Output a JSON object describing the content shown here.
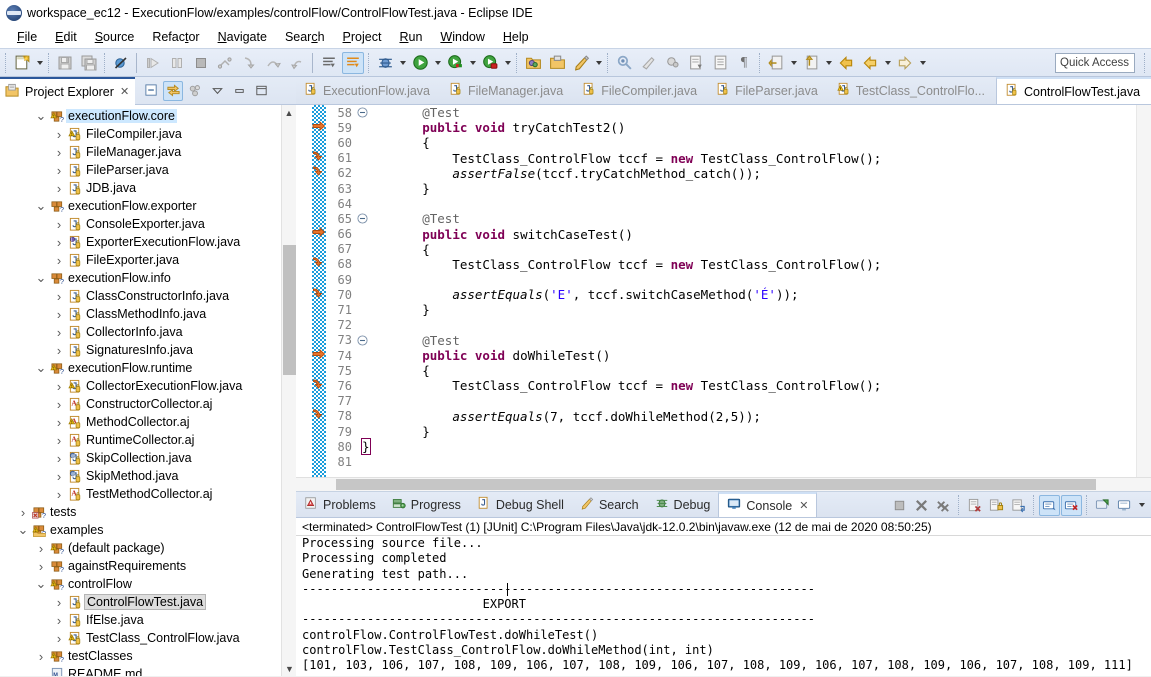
{
  "window": {
    "title": "workspace_ec12 - ExecutionFlow/examples/controlFlow/ControlFlowTest.java - Eclipse IDE",
    "logo_icon": "eclipse-logo-icon"
  },
  "menubar": {
    "items": [
      {
        "label": "File",
        "mnemonic": "F"
      },
      {
        "label": "Edit",
        "mnemonic": "E"
      },
      {
        "label": "Source",
        "mnemonic": "S"
      },
      {
        "label": "Refactor",
        "mnemonic": "t"
      },
      {
        "label": "Navigate",
        "mnemonic": "N"
      },
      {
        "label": "Search",
        "mnemonic": "c"
      },
      {
        "label": "Project",
        "mnemonic": "P"
      },
      {
        "label": "Run",
        "mnemonic": "R"
      },
      {
        "label": "Window",
        "mnemonic": "W"
      },
      {
        "label": "Help",
        "mnemonic": "H"
      }
    ]
  },
  "toolbar": {
    "quick_access_placeholder": "Quick Access",
    "buttons": [
      {
        "name": "new-wizard-icon",
        "tooltip": "New"
      },
      {
        "name": "save-icon",
        "tooltip": "Save"
      },
      {
        "name": "save-all-icon",
        "tooltip": "Save All"
      },
      {
        "name": "skip-all-breakpoints-icon",
        "tooltip": "Skip All Breakpoints"
      },
      {
        "name": "resume-icon",
        "tooltip": "Resume"
      },
      {
        "name": "suspend-icon",
        "tooltip": "Suspend"
      },
      {
        "name": "terminate-icon",
        "tooltip": "Terminate"
      },
      {
        "name": "disconnect-icon",
        "tooltip": "Disconnect"
      },
      {
        "name": "step-into-icon",
        "tooltip": "Step Into"
      },
      {
        "name": "step-over-icon",
        "tooltip": "Step Over"
      },
      {
        "name": "step-return-icon",
        "tooltip": "Step Return"
      },
      {
        "name": "next-annotation-icon",
        "tooltip": "Next Annotation"
      },
      {
        "name": "toggle-mark-occurrences-icon",
        "tooltip": "Toggle Mark Occurrences"
      },
      {
        "name": "debug-icon",
        "tooltip": "Debug"
      },
      {
        "name": "run-icon",
        "tooltip": "Run"
      },
      {
        "name": "coverage-icon",
        "tooltip": "Coverage"
      },
      {
        "name": "external-tools-icon",
        "tooltip": "External Tools"
      },
      {
        "name": "new-java-project-icon",
        "tooltip": "New Java Project"
      },
      {
        "name": "new-java-package-icon",
        "tooltip": "New Java Package"
      },
      {
        "name": "new-class-icon",
        "tooltip": "New Class"
      },
      {
        "name": "search-icon",
        "tooltip": "Search"
      },
      {
        "name": "open-task-icon",
        "tooltip": "Open Task"
      },
      {
        "name": "link-icon",
        "tooltip": "Link"
      },
      {
        "name": "open-type-icon",
        "tooltip": "Open Type"
      },
      {
        "name": "show-whitespace-icon",
        "tooltip": "Show Whitespace Characters"
      },
      {
        "name": "pilcrow-icon",
        "tooltip": "Show Paragraph Marks"
      },
      {
        "name": "previous-edit-icon",
        "tooltip": "Previous Edit Location"
      },
      {
        "name": "next-edit-icon",
        "tooltip": "Next Edit Location"
      },
      {
        "name": "back-icon",
        "tooltip": "Back"
      },
      {
        "name": "forward-icon",
        "tooltip": "Forward"
      }
    ]
  },
  "explorer": {
    "tab_label": "Project Explorer",
    "tab_icon": "project-explorer-icon",
    "close_icon": "close-icon",
    "tools": [
      {
        "name": "collapse-all-icon"
      },
      {
        "name": "link-with-editor-icon",
        "active": true
      },
      {
        "name": "focus-on-active-task-icon"
      },
      {
        "name": "view-menu-icon"
      },
      {
        "name": "minimize-icon"
      },
      {
        "name": "maximize-icon"
      }
    ],
    "tree": [
      {
        "label": "executionFlow.core",
        "indent": 1,
        "twisty": "open",
        "icon": "package-warning-icon",
        "selected": "blue"
      },
      {
        "label": "FileCompiler.java",
        "indent": 2,
        "twisty": "closed",
        "icon": "java-warning-icon"
      },
      {
        "label": "FileManager.java",
        "indent": 2,
        "twisty": "closed",
        "icon": "java-icon"
      },
      {
        "label": "FileParser.java",
        "indent": 2,
        "twisty": "closed",
        "icon": "java-icon"
      },
      {
        "label": "JDB.java",
        "indent": 2,
        "twisty": "closed",
        "icon": "java-icon"
      },
      {
        "label": "executionFlow.exporter",
        "indent": 1,
        "twisty": "open",
        "icon": "package-icon"
      },
      {
        "label": "ConsoleExporter.java",
        "indent": 2,
        "twisty": "closed",
        "icon": "java-icon"
      },
      {
        "label": "ExporterExecutionFlow.java",
        "indent": 2,
        "twisty": "closed",
        "icon": "java-interface-icon"
      },
      {
        "label": "FileExporter.java",
        "indent": 2,
        "twisty": "closed",
        "icon": "java-icon"
      },
      {
        "label": "executionFlow.info",
        "indent": 1,
        "twisty": "open",
        "icon": "package-icon"
      },
      {
        "label": "ClassConstructorInfo.java",
        "indent": 2,
        "twisty": "closed",
        "icon": "java-icon"
      },
      {
        "label": "ClassMethodInfo.java",
        "indent": 2,
        "twisty": "closed",
        "icon": "java-icon"
      },
      {
        "label": "CollectorInfo.java",
        "indent": 2,
        "twisty": "closed",
        "icon": "java-icon"
      },
      {
        "label": "SignaturesInfo.java",
        "indent": 2,
        "twisty": "closed",
        "icon": "java-icon"
      },
      {
        "label": "executionFlow.runtime",
        "indent": 1,
        "twisty": "open",
        "icon": "package-warning-icon"
      },
      {
        "label": "CollectorExecutionFlow.java",
        "indent": 2,
        "twisty": "closed",
        "icon": "java-warning-icon"
      },
      {
        "label": "ConstructorCollector.aj",
        "indent": 2,
        "twisty": "closed",
        "icon": "aspect-icon"
      },
      {
        "label": "MethodCollector.aj",
        "indent": 2,
        "twisty": "closed",
        "icon": "aspect-warning-icon"
      },
      {
        "label": "RuntimeCollector.aj",
        "indent": 2,
        "twisty": "closed",
        "icon": "aspect-icon"
      },
      {
        "label": "SkipCollection.java",
        "indent": 2,
        "twisty": "closed",
        "icon": "java-annotation-icon"
      },
      {
        "label": "SkipMethod.java",
        "indent": 2,
        "twisty": "closed",
        "icon": "java-annotation-icon"
      },
      {
        "label": "TestMethodCollector.aj",
        "indent": 2,
        "twisty": "closed",
        "icon": "aspect-icon"
      },
      {
        "label": "tests",
        "indent": 0,
        "twisty": "closed",
        "icon": "source-folder-error-icon"
      },
      {
        "label": "examples",
        "indent": 0,
        "twisty": "open",
        "icon": "source-folder-warning-icon"
      },
      {
        "label": "(default package)",
        "indent": 1,
        "twisty": "closed",
        "icon": "package-warning-icon"
      },
      {
        "label": "againstRequirements",
        "indent": 1,
        "twisty": "closed",
        "icon": "package-icon"
      },
      {
        "label": "controlFlow",
        "indent": 1,
        "twisty": "open",
        "icon": "package-warning-icon"
      },
      {
        "label": "ControlFlowTest.java",
        "indent": 2,
        "twisty": "closed",
        "icon": "java-icon",
        "selected": "grey"
      },
      {
        "label": "IfElse.java",
        "indent": 2,
        "twisty": "closed",
        "icon": "java-icon"
      },
      {
        "label": "TestClass_ControlFlow.java",
        "indent": 2,
        "twisty": "closed",
        "icon": "java-warning-icon"
      },
      {
        "label": "testClasses",
        "indent": 1,
        "twisty": "closed",
        "icon": "package-warning-icon"
      },
      {
        "label": "README.md",
        "indent": 1,
        "twisty": "none",
        "icon": "markdown-icon"
      }
    ]
  },
  "editor": {
    "tabs": [
      {
        "label": "ExecutionFlow.java",
        "icon": "java-icon",
        "active": false
      },
      {
        "label": "FileManager.java",
        "icon": "java-icon",
        "active": false
      },
      {
        "label": "FileCompiler.java",
        "icon": "java-icon",
        "active": false
      },
      {
        "label": "FileParser.java",
        "icon": "java-icon",
        "active": false
      },
      {
        "label": "TestClass_ControlFlo...",
        "icon": "java-warning-icon",
        "active": false
      },
      {
        "label": "ControlFlowTest.java",
        "icon": "java-icon",
        "active": true
      }
    ],
    "first_line": 58,
    "lines": [
      {
        "n": 58,
        "fold": true,
        "bp": false,
        "tokens": [
          {
            "t": "        ",
            "c": "plain"
          },
          {
            "t": "@Test",
            "c": "ann"
          }
        ]
      },
      {
        "n": 59,
        "fold": false,
        "bp": "arrow",
        "tokens": [
          {
            "t": "        ",
            "c": "plain"
          },
          {
            "t": "public",
            "c": "kw"
          },
          {
            "t": " ",
            "c": "plain"
          },
          {
            "t": "void",
            "c": "kw"
          },
          {
            "t": " tryCatchTest2()",
            "c": "plain"
          }
        ]
      },
      {
        "n": 60,
        "fold": false,
        "bp": false,
        "tokens": [
          {
            "t": "        {",
            "c": "plain"
          }
        ]
      },
      {
        "n": 61,
        "fold": false,
        "bp": "hook",
        "tokens": [
          {
            "t": "            TestClass_ControlFlow tccf = ",
            "c": "plain"
          },
          {
            "t": "new",
            "c": "kw"
          },
          {
            "t": " TestClass_ControlFlow();",
            "c": "plain"
          }
        ]
      },
      {
        "n": 62,
        "fold": false,
        "bp": "hook",
        "tokens": [
          {
            "t": "            ",
            "c": "plain"
          },
          {
            "t": "assertFalse",
            "c": "mth"
          },
          {
            "t": "(tccf.tryCatchMethod_catch());",
            "c": "plain"
          }
        ]
      },
      {
        "n": 63,
        "fold": false,
        "bp": false,
        "tokens": [
          {
            "t": "        }",
            "c": "plain"
          }
        ]
      },
      {
        "n": 64,
        "fold": false,
        "bp": false,
        "tokens": [
          {
            "t": "",
            "c": "plain"
          }
        ]
      },
      {
        "n": 65,
        "fold": true,
        "bp": false,
        "tokens": [
          {
            "t": "        ",
            "c": "plain"
          },
          {
            "t": "@Test",
            "c": "ann"
          }
        ]
      },
      {
        "n": 66,
        "fold": false,
        "bp": "arrow",
        "tokens": [
          {
            "t": "        ",
            "c": "plain"
          },
          {
            "t": "public",
            "c": "kw"
          },
          {
            "t": " ",
            "c": "plain"
          },
          {
            "t": "void",
            "c": "kw"
          },
          {
            "t": " switchCaseTest()",
            "c": "plain"
          }
        ]
      },
      {
        "n": 67,
        "fold": false,
        "bp": false,
        "tokens": [
          {
            "t": "        {",
            "c": "plain"
          }
        ]
      },
      {
        "n": 68,
        "fold": false,
        "bp": "hook",
        "tokens": [
          {
            "t": "            TestClass_ControlFlow tccf = ",
            "c": "plain"
          },
          {
            "t": "new",
            "c": "kw"
          },
          {
            "t": " TestClass_ControlFlow();",
            "c": "plain"
          }
        ]
      },
      {
        "n": 69,
        "fold": false,
        "bp": false,
        "tokens": [
          {
            "t": "",
            "c": "plain"
          }
        ]
      },
      {
        "n": 70,
        "fold": false,
        "bp": "hook",
        "tokens": [
          {
            "t": "            ",
            "c": "plain"
          },
          {
            "t": "assertEquals",
            "c": "mth"
          },
          {
            "t": "(",
            "c": "plain"
          },
          {
            "t": "'E'",
            "c": "str"
          },
          {
            "t": ", tccf.switchCaseMethod(",
            "c": "plain"
          },
          {
            "t": "'É'",
            "c": "str"
          },
          {
            "t": "));",
            "c": "plain"
          }
        ]
      },
      {
        "n": 71,
        "fold": false,
        "bp": false,
        "tokens": [
          {
            "t": "        }",
            "c": "plain"
          }
        ]
      },
      {
        "n": 72,
        "fold": false,
        "bp": false,
        "tokens": [
          {
            "t": "",
            "c": "plain"
          }
        ]
      },
      {
        "n": 73,
        "fold": true,
        "bp": false,
        "tokens": [
          {
            "t": "        ",
            "c": "plain"
          },
          {
            "t": "@Test",
            "c": "ann"
          }
        ]
      },
      {
        "n": 74,
        "fold": false,
        "bp": "arrow",
        "tokens": [
          {
            "t": "        ",
            "c": "plain"
          },
          {
            "t": "public",
            "c": "kw"
          },
          {
            "t": " ",
            "c": "plain"
          },
          {
            "t": "void",
            "c": "kw"
          },
          {
            "t": " doWhileTest()",
            "c": "plain"
          }
        ]
      },
      {
        "n": 75,
        "fold": false,
        "bp": false,
        "tokens": [
          {
            "t": "        {",
            "c": "plain"
          }
        ]
      },
      {
        "n": 76,
        "fold": false,
        "bp": "hook",
        "tokens": [
          {
            "t": "            TestClass_ControlFlow tccf = ",
            "c": "plain"
          },
          {
            "t": "new",
            "c": "kw"
          },
          {
            "t": " TestClass_ControlFlow();",
            "c": "plain"
          }
        ]
      },
      {
        "n": 77,
        "fold": false,
        "bp": false,
        "tokens": [
          {
            "t": "",
            "c": "plain"
          }
        ]
      },
      {
        "n": 78,
        "fold": false,
        "bp": "hook",
        "tokens": [
          {
            "t": "            ",
            "c": "plain"
          },
          {
            "t": "assertEquals",
            "c": "mth"
          },
          {
            "t": "(7, tccf.doWhileMethod(2,5));",
            "c": "plain"
          }
        ]
      },
      {
        "n": 79,
        "fold": false,
        "bp": false,
        "tokens": [
          {
            "t": "        }",
            "c": "plain"
          }
        ]
      },
      {
        "n": 80,
        "fold": false,
        "bp": false,
        "tokens": [
          {
            "t": "}",
            "c": "brace"
          }
        ]
      },
      {
        "n": 81,
        "fold": false,
        "bp": false,
        "tokens": [
          {
            "t": "",
            "c": "plain"
          }
        ]
      }
    ]
  },
  "console": {
    "tabs": [
      {
        "label": "Problems",
        "icon": "problems-icon",
        "active": false
      },
      {
        "label": "Progress",
        "icon": "progress-icon",
        "active": false
      },
      {
        "label": "Debug Shell",
        "icon": "debug-shell-icon",
        "active": false
      },
      {
        "label": "Search",
        "icon": "search-icon",
        "active": false
      },
      {
        "label": "Debug",
        "icon": "debug-icon",
        "active": false
      },
      {
        "label": "Console",
        "icon": "console-icon",
        "active": true
      }
    ],
    "close_icon": "close-icon",
    "tools": [
      {
        "name": "terminate-icon"
      },
      {
        "name": "remove-launch-icon"
      },
      {
        "name": "remove-all-terminated-icon"
      },
      {
        "name": "clear-console-icon"
      },
      {
        "name": "scroll-lock-icon"
      },
      {
        "name": "word-wrap-icon"
      },
      {
        "name": "show-console-on-output-icon",
        "active": true
      },
      {
        "name": "show-console-on-error-icon",
        "active": true
      },
      {
        "name": "pin-console-icon"
      },
      {
        "name": "display-selected-console-icon"
      },
      {
        "name": "open-console-menu-icon"
      }
    ],
    "header": "<terminated> ControlFlowTest (1) [JUnit] C:\\Program Files\\Java\\jdk-12.0.2\\bin\\javaw.exe (12 de mai de 2020 08:50:25)",
    "output": [
      "Processing source file...",
      "Processing completed",
      "Generating test path...",
      "-----------------------------------------------------------------------",
      "                         EXPORT",
      "-----------------------------------------------------------------------",
      "controlFlow.ControlFlowTest.doWhileTest()",
      "controlFlow.TestClass_ControlFlow.doWhileMethod(int, int)",
      "[101, 103, 106, 107, 108, 109, 106, 107, 108, 109, 106, 107, 108, 109, 106, 107, 108, 109, 106, 107, 108, 109, 111]"
    ]
  },
  "colors": {
    "accent": "#2b579a",
    "toolbar_bg": "#e4ebf6",
    "keyword": "#7f0055",
    "string": "#2a00ff",
    "annotation": "#646464",
    "selection_blue": "#cde8ff",
    "annotation_strip": "#1a9ddc"
  }
}
